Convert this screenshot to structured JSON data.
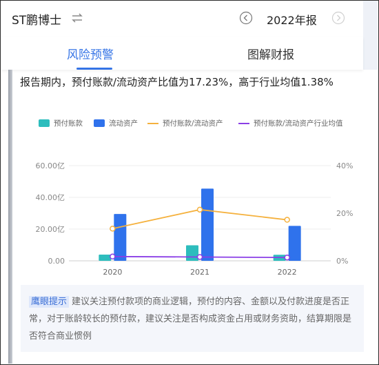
{
  "header": {
    "company_name": "ST鹏博士",
    "year_label": "2022年报",
    "icons": [
      "swap-icon",
      "chevron-left-circle-icon",
      "chevron-right-circle-icon"
    ]
  },
  "tabs": [
    {
      "label": "风险预警",
      "active": true
    },
    {
      "label": "图解财报",
      "active": false
    }
  ],
  "summary_text": "报告期内，预付账款/流动资产比值为17.23%，高于行业均值1.38%",
  "legend": [
    {
      "label": "预付账款",
      "color": "#2dbdbd",
      "kind": "bar"
    },
    {
      "label": "流动资产",
      "color": "#2f72ec",
      "kind": "bar"
    },
    {
      "label": "预付账款/流动资产",
      "color": "#f5b13d",
      "kind": "line"
    },
    {
      "label": "预付账款/流动资产行业均值",
      "color": "#8a3ee6",
      "kind": "line"
    }
  ],
  "chart_data": {
    "type": "bar",
    "categories": [
      "2020",
      "2021",
      "2022"
    ],
    "series": [
      {
        "name": "预付账款",
        "type": "bar",
        "axis": "left",
        "color": "#2dbdbd",
        "values": [
          3.9,
          9.8,
          3.8
        ]
      },
      {
        "name": "流动资产",
        "type": "bar",
        "axis": "left",
        "color": "#2f72ec",
        "values": [
          29.5,
          45.5,
          22.0
        ]
      },
      {
        "name": "预付账款/流动资产",
        "type": "line",
        "axis": "right",
        "color": "#f5b13d",
        "values": [
          13.5,
          21.5,
          17.23
        ]
      },
      {
        "name": "预付账款/流动资产行业均值",
        "type": "line",
        "axis": "right",
        "color": "#8a3ee6",
        "values": [
          1.8,
          1.6,
          1.38
        ]
      }
    ],
    "y_left": {
      "ticks": [
        "60.00亿",
        "40.00亿",
        "20.00亿",
        "0.00"
      ],
      "range": [
        0,
        60
      ]
    },
    "y_right": {
      "ticks": [
        "40%",
        "20%",
        "0%"
      ],
      "range": [
        0,
        40
      ]
    },
    "grid": true,
    "legend_position": "top"
  },
  "tip": {
    "tag": "鹰眼提示",
    "text": "建议关注预付款项的商业逻辑，预付的内容、金额以及付款进度是否正常，对于账龄较长的预付款，建议关注是否构成资金占用或财务资助，结算期限是否符合商业惯例"
  }
}
